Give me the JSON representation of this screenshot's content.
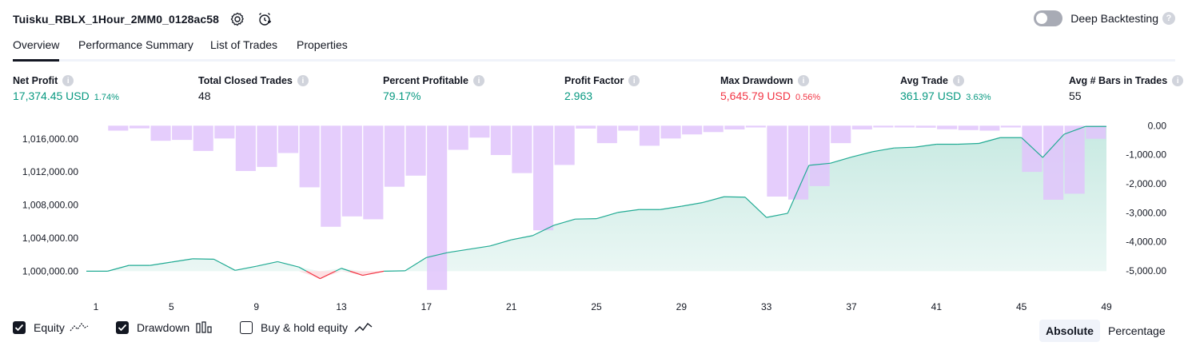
{
  "header": {
    "title": "Tuisku_RBLX_1Hour_2MM0_0128ac58",
    "deep_backtesting_label": "Deep Backtesting",
    "help": "?"
  },
  "tabs": [
    {
      "label": "Overview",
      "active": true
    },
    {
      "label": "Performance Summary",
      "active": false
    },
    {
      "label": "List of Trades",
      "active": false
    },
    {
      "label": "Properties",
      "active": false
    }
  ],
  "metrics": [
    {
      "label": "Net Profit",
      "value": "17,374.45 USD",
      "pct": "1.74%",
      "color": "green"
    },
    {
      "label": "Total Closed Trades",
      "value": "48",
      "pct": "",
      "color": "dark"
    },
    {
      "label": "Percent Profitable",
      "value": "79.17%",
      "pct": "",
      "color": "green"
    },
    {
      "label": "Profit Factor",
      "value": "2.963",
      "pct": "",
      "color": "green"
    },
    {
      "label": "Max Drawdown",
      "value": "5,645.79 USD",
      "pct": "0.56%",
      "color": "red"
    },
    {
      "label": "Avg Trade",
      "value": "361.97 USD",
      "pct": "3.63%",
      "color": "green"
    },
    {
      "label": "Avg # Bars in Trades",
      "value": "55",
      "pct": "",
      "color": "dark"
    }
  ],
  "chart_data": {
    "type": "area",
    "x": [
      1,
      2,
      3,
      4,
      5,
      6,
      7,
      8,
      9,
      10,
      11,
      12,
      13,
      14,
      15,
      16,
      17,
      18,
      19,
      20,
      21,
      22,
      23,
      24,
      25,
      26,
      27,
      28,
      29,
      30,
      31,
      32,
      33,
      34,
      35,
      36,
      37,
      38,
      39,
      40,
      41,
      42,
      43,
      44,
      45,
      46,
      47,
      48,
      49
    ],
    "x_ticks": [
      "1",
      "5",
      "9",
      "13",
      "17",
      "21",
      "25",
      "29",
      "33",
      "37",
      "41",
      "45",
      "49"
    ],
    "left_ticks": [
      "1,016,000.00",
      "1,012,000.00",
      "1,008,000.00",
      "1,004,000.00",
      "1,000,000.00"
    ],
    "left_tick_values": [
      1016000,
      1012000,
      1008000,
      1004000,
      1000000
    ],
    "right_ticks": [
      "0.00",
      "-1,000.00",
      "-2,000.00",
      "-3,000.00",
      "-4,000.00",
      "-5,000.00"
    ],
    "right_tick_values": [
      0,
      -1000,
      -2000,
      -3000,
      -4000,
      -5000
    ],
    "left_range": [
      998200,
      1018300
    ],
    "right_range": [
      -5520,
      200
    ],
    "baseline": 1000000,
    "series": [
      {
        "name": "Equity",
        "values": [
          1000000,
          1000000,
          1000700,
          1000700,
          1001100,
          1001500,
          1001450,
          1000100,
          1000600,
          1001150,
          1000500,
          999100,
          1000350,
          999500,
          1000000,
          1000050,
          1001650,
          1002250,
          1002650,
          1003050,
          1003800,
          1004300,
          1005550,
          1006300,
          1006350,
          1007100,
          1007450,
          1007450,
          1007850,
          1008300,
          1009000,
          1008950,
          1006500,
          1007000,
          1012800,
          1013050,
          1013800,
          1014450,
          1014900,
          1015000,
          1015350,
          1015350,
          1015450,
          1016150,
          1016150,
          1013750,
          1016550,
          1017500,
          1017500
        ]
      },
      {
        "name": "Drawdown",
        "values": [
          0,
          -170,
          -90,
          -520,
          -490,
          -870,
          -440,
          -1560,
          -1420,
          -940,
          -2120,
          -3480,
          -3120,
          -3220,
          -2100,
          -1720,
          -5650,
          -830,
          -410,
          -1010,
          -1630,
          -3600,
          -1350,
          -100,
          -600,
          -170,
          -690,
          -440,
          -300,
          -220,
          -130,
          -60,
          -2440,
          -2540,
          -2080,
          -600,
          -130,
          -60,
          -60,
          -70,
          -120,
          -150,
          -170,
          -60,
          -1590,
          -2550,
          -2340,
          -450,
          0
        ]
      }
    ],
    "colors": {
      "equity_positive": "#22ab94",
      "equity_negative": "#f23645",
      "drawdown": "#e1c4fb",
      "fill_positive": "#c4e8e0",
      "fill_negative": "#fde1e4"
    }
  },
  "legend": {
    "equity_label": "Equity",
    "drawdown_label": "Drawdown",
    "buyhold_label": "Buy & hold equity"
  },
  "buttons": {
    "absolute": "Absolute",
    "percentage": "Percentage"
  }
}
